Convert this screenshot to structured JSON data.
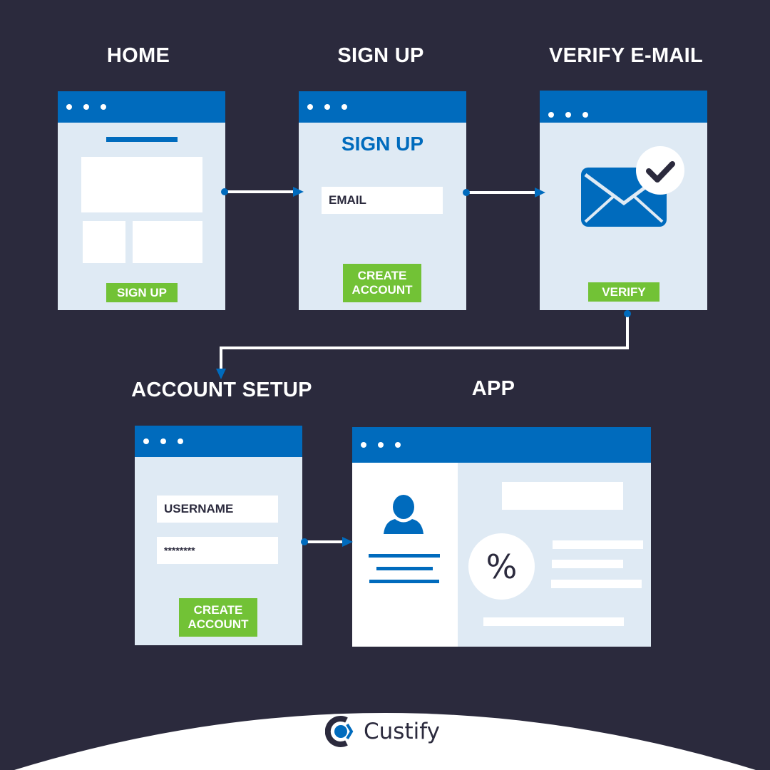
{
  "colors": {
    "background": "#2b2a3d",
    "window_bar": "#006bbd",
    "window_body": "#dfeaf4",
    "button": "#72c236",
    "text_dark": "#2b2a3d",
    "white": "#ffffff"
  },
  "steps": [
    {
      "title": "HOME",
      "button": "SIGN UP"
    },
    {
      "title": "SIGN UP",
      "heading": "SIGN UP",
      "field": "EMAIL",
      "button_line1": "CREATE",
      "button_line2": "ACCOUNT"
    },
    {
      "title": "VERIFY E-MAIL",
      "icon": "envelope-check-icon",
      "button": "VERIFY"
    },
    {
      "title": "ACCOUNT SETUP",
      "username_field": "USERNAME",
      "password_field": "********",
      "button_line1": "CREATE",
      "button_line2": "ACCOUNT"
    },
    {
      "title": "APP",
      "percent_symbol": "%",
      "icons": [
        "user-icon",
        "percent-icon"
      ]
    }
  ],
  "flow": [
    "HOME",
    "SIGN UP",
    "VERIFY E-MAIL",
    "ACCOUNT SETUP",
    "APP"
  ],
  "footer": {
    "brand": "Custify"
  }
}
